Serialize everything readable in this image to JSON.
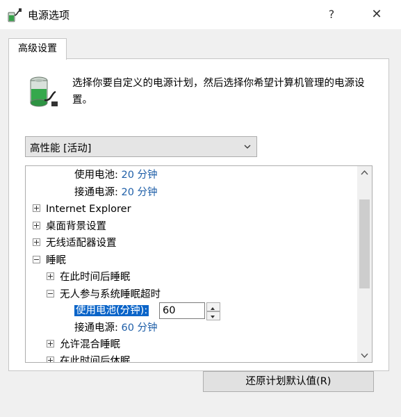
{
  "window": {
    "title": "电源选项",
    "help_glyph": "?",
    "close_glyph": "✕"
  },
  "tab": {
    "label": "高级设置"
  },
  "description": "选择你要自定义的电源计划，然后选择你希望计算机管理的电源设置。",
  "plan_select": {
    "value": "高性能 [活动]"
  },
  "tree": {
    "row0": {
      "label": "使用电池:",
      "value": "20 分钟"
    },
    "row1": {
      "label": "接通电源:",
      "value": "20 分钟"
    },
    "row2": {
      "label": "Internet Explorer"
    },
    "row3": {
      "label": "桌面背景设置"
    },
    "row4": {
      "label": "无线适配器设置"
    },
    "row5": {
      "label": "睡眠"
    },
    "row6": {
      "label": "在此时间后睡眠"
    },
    "row7": {
      "label": "无人参与系统睡眠超时"
    },
    "row8": {
      "label": "使用电池(分钟):",
      "input_value": "60"
    },
    "row9": {
      "label": "接通电源:",
      "value": "60 分钟"
    },
    "row10": {
      "label": "允许混合睡眠"
    },
    "row11": {
      "label": "在此时间后休眠"
    }
  },
  "buttons": {
    "restore": "还原计划默认值(R)"
  },
  "colors": {
    "accent": "#0a64c8",
    "value_blue": "#1f5fa8"
  }
}
